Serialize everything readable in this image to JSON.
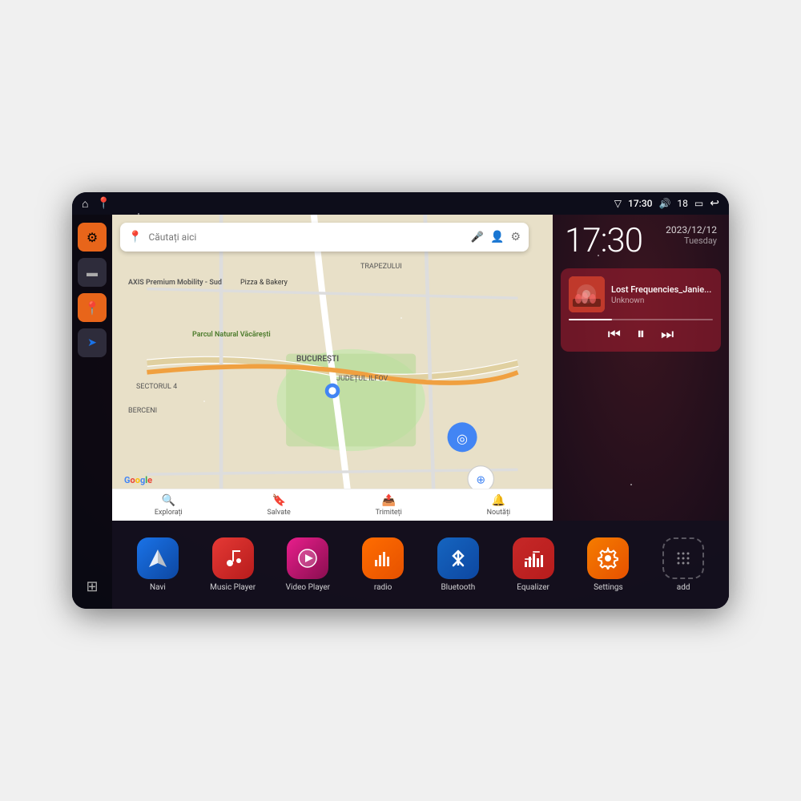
{
  "device": {
    "title": "Car Android Head Unit"
  },
  "statusBar": {
    "wifi_icon": "▼",
    "time": "17:30",
    "volume_icon": "🔊",
    "battery_level": "18",
    "battery_icon": "🔋",
    "back_icon": "↩"
  },
  "clock": {
    "time": "17:30",
    "date": "2023/12/12",
    "day": "Tuesday"
  },
  "music": {
    "title": "Lost Frequencies_Janie...",
    "artist": "Unknown",
    "album_art": "🎵"
  },
  "map": {
    "search_placeholder": "Căutați aici",
    "location1": "AXIS Premium Mobility - Sud",
    "location2": "Pizza & Bakery",
    "location3": "Parcul Natural Văcărești",
    "location4": "BUCUREȘTI",
    "location5": "SECTORUL 4",
    "location6": "BERCENI",
    "location7": "JUDEȚUL ILFOV",
    "location8": "TRAPEZULUI",
    "nav_explore": "Explorați",
    "nav_saved": "Salvate",
    "nav_send": "Trimiteți",
    "nav_news": "Noutăți"
  },
  "sidebar": {
    "items": [
      {
        "id": "settings",
        "icon": "⚙",
        "color": "orange"
      },
      {
        "id": "files",
        "icon": "▬",
        "color": "dark"
      },
      {
        "id": "maps",
        "icon": "📍",
        "color": "orange"
      },
      {
        "id": "navigation",
        "icon": "➤",
        "color": "dark"
      }
    ],
    "grid_icon": "⊞"
  },
  "apps": [
    {
      "id": "navi",
      "label": "Navi",
      "icon": "➤",
      "class": "icon-navi"
    },
    {
      "id": "music-player",
      "label": "Music Player",
      "icon": "♪",
      "class": "icon-music"
    },
    {
      "id": "video-player",
      "label": "Video Player",
      "icon": "▶",
      "class": "icon-video"
    },
    {
      "id": "radio",
      "label": "radio",
      "icon": "📻",
      "class": "icon-radio"
    },
    {
      "id": "bluetooth",
      "label": "Bluetooth",
      "icon": "⚡",
      "class": "icon-bluetooth"
    },
    {
      "id": "equalizer",
      "label": "Equalizer",
      "icon": "≡",
      "class": "icon-equalizer"
    },
    {
      "id": "settings",
      "label": "Settings",
      "icon": "⚙",
      "class": "icon-settings"
    },
    {
      "id": "add",
      "label": "add",
      "icon": "+",
      "class": "icon-add"
    }
  ]
}
